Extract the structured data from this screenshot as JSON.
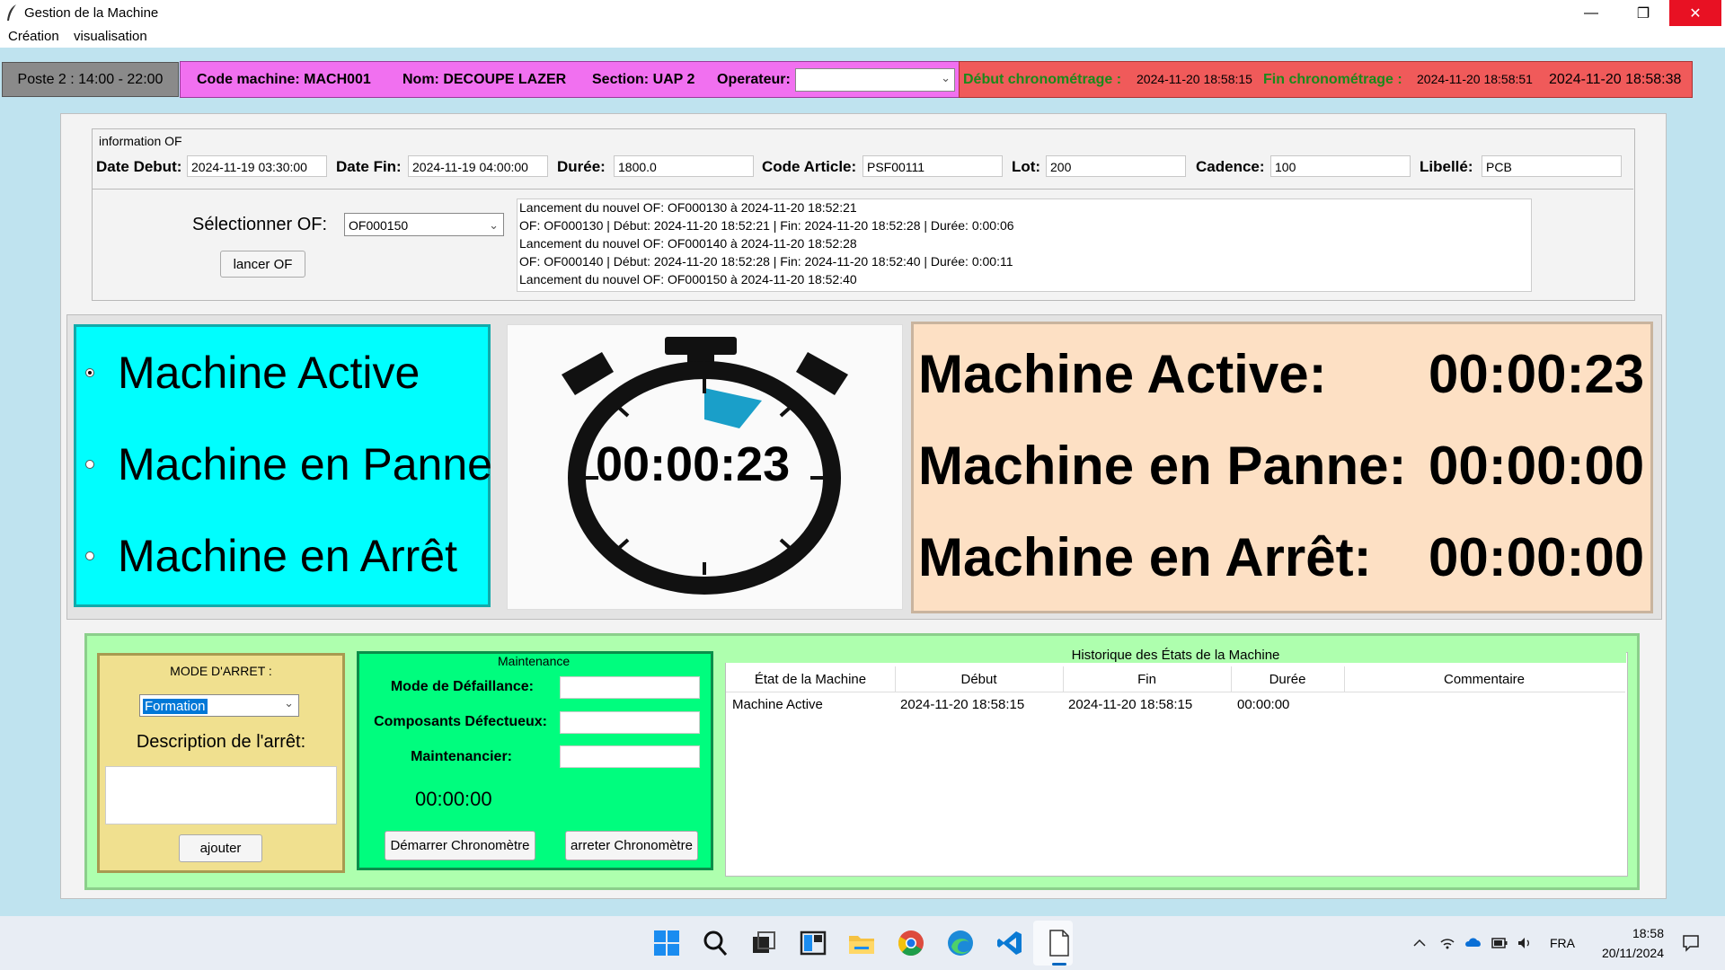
{
  "window": {
    "title": "Gestion de la Machine",
    "controls": [
      "minimize-icon",
      "restore-icon",
      "close-icon"
    ]
  },
  "menu": [
    "Création",
    "visualisation"
  ],
  "header": {
    "poste": "Poste 2 : 14:00 - 22:00",
    "code_machine": "Code machine: MACH001",
    "nom": "Nom: DECOUPE LAZER",
    "section": "Section: UAP 2",
    "operateur_label": "Operateur:",
    "operateur_value": "",
    "debut_label": "Début chronométrage :",
    "debut_value": "2024-11-20 18:58:15",
    "fin_label": "Fin chronométrage :",
    "fin_value": "2024-11-20 18:58:51",
    "clock": "2024-11-20 18:58:38",
    "debut_color": "#1a8a1a",
    "fin_color": "#1a8a1a"
  },
  "of_info": {
    "group_label": "information OF",
    "fields": [
      {
        "label": "Date Debut:",
        "value": "2024-11-19 03:30:00"
      },
      {
        "label": "Date Fin:",
        "value": "2024-11-19 04:00:00"
      },
      {
        "label": "Durée:",
        "value": "1800.0"
      },
      {
        "label": "Code Article:",
        "value": "PSF00111"
      },
      {
        "label": "Lot:",
        "value": "200"
      },
      {
        "label": "Cadence:",
        "value": "100"
      },
      {
        "label": "Libellé:",
        "value": "PCB"
      }
    ],
    "select_label": "Sélectionner OF:",
    "select_value": "OF000150",
    "launch_button": "lancer OF",
    "log": [
      "Lancement du nouvel OF: OF000130 à 2024-11-20 18:52:21",
      "OF: OF000130 | Début: 2024-11-20 18:52:21 | Fin: 2024-11-20 18:52:28 | Durée: 0:00:06",
      "Lancement du nouvel OF: OF000140 à 2024-11-20 18:52:28",
      "OF: OF000140 | Début: 2024-11-20 18:52:28 | Fin: 2024-11-20 18:52:40 | Durée: 0:00:11",
      "Lancement du nouvel OF: OF000150 à 2024-11-20 18:52:40"
    ]
  },
  "states": {
    "options": [
      {
        "label": "Machine Active",
        "selected": true
      },
      {
        "label": "Machine en Panne",
        "selected": false
      },
      {
        "label": "Machine en Arrêt",
        "selected": false
      }
    ],
    "stopwatch": "00:00:23",
    "totals": [
      {
        "label": "Machine Active:",
        "value": "00:00:23"
      },
      {
        "label": "Machine en Panne:",
        "value": "00:00:00"
      },
      {
        "label": "Machine en Arrêt:",
        "value": "00:00:00"
      }
    ],
    "radio_bg": "#00fefe",
    "totals_bg": "#fde0c4"
  },
  "arret": {
    "title": "MODE D'ARRET :",
    "mode_value": "Formation",
    "desc_label": "Description de l'arrêt:",
    "desc_value": "",
    "add_button": "ajouter"
  },
  "maintenance": {
    "title": "Maintenance",
    "fields": [
      {
        "label": "Mode de Défaillance:",
        "value": ""
      },
      {
        "label": "Composants Défectueux:",
        "value": ""
      },
      {
        "label": "Maintenancier:",
        "value": ""
      }
    ],
    "chrono": "00:00:00",
    "start_button": "Démarrer Chronomètre",
    "stop_button": "arreter Chronomètre"
  },
  "history": {
    "title": "Historique des États de la Machine",
    "columns": [
      "État de la Machine",
      "Début",
      "Fin",
      "Durée",
      "Commentaire"
    ],
    "rows": [
      [
        "Machine Active",
        "2024-11-20 18:58:15",
        "2024-11-20 18:58:15",
        "00:00:00",
        ""
      ]
    ]
  },
  "taskbar": {
    "icons": [
      "windows-start-icon",
      "search-icon",
      "task-view-icon",
      "widgets-icon",
      "file-explorer-icon",
      "chrome-icon",
      "edge-icon",
      "vscode-icon",
      "document-app-icon"
    ],
    "tray_icons": [
      "chevron-up-icon",
      "wifi-icon",
      "onedrive-icon",
      "battery-icon",
      "volume-icon"
    ],
    "language": "FRA",
    "time": "18:58",
    "date": "20/11/2024"
  }
}
